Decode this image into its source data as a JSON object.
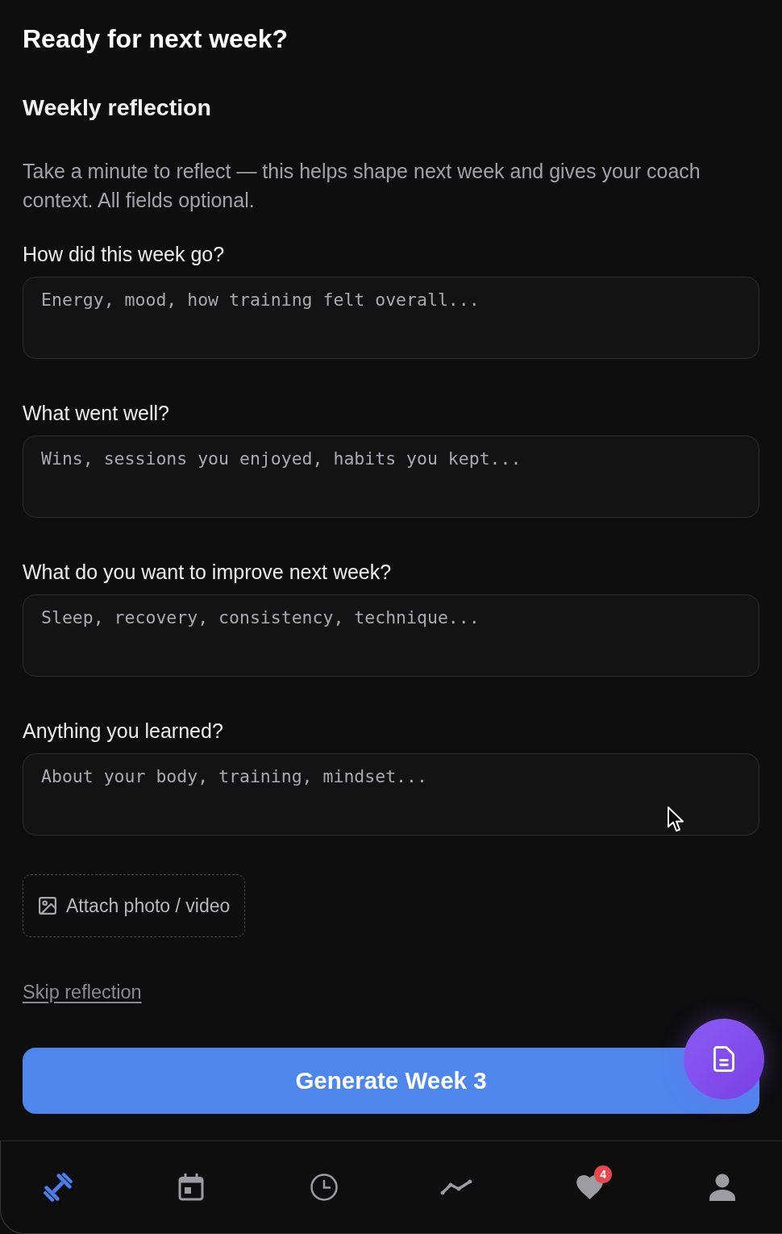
{
  "header": {
    "title": "Ready for next week?"
  },
  "section": {
    "title": "Weekly reflection",
    "description": "Take a minute to reflect — this helps shape next week and gives your coach context. All fields optional."
  },
  "questions": [
    {
      "label": "How did this week go?",
      "placeholder": "Energy, mood, how training felt overall..."
    },
    {
      "label": "What went well?",
      "placeholder": "Wins, sessions you enjoyed, habits you kept..."
    },
    {
      "label": "What do you want to improve next week?",
      "placeholder": "Sleep, recovery, consistency, technique..."
    },
    {
      "label": "Anything you learned?",
      "placeholder": "About your body, training, mindset..."
    }
  ],
  "attach_button": {
    "label": "Attach photo / video"
  },
  "skip_link": {
    "label": "Skip reflection"
  },
  "primary_button": {
    "label": "Generate Week 3"
  },
  "nav": {
    "items": [
      {
        "kind": "dumbbell",
        "selected": true
      },
      {
        "kind": "calendar",
        "selected": false
      },
      {
        "kind": "clock",
        "selected": false
      },
      {
        "kind": "chart",
        "selected": false
      },
      {
        "kind": "heart",
        "selected": false,
        "badge": "4"
      },
      {
        "kind": "person",
        "selected": false
      }
    ]
  }
}
